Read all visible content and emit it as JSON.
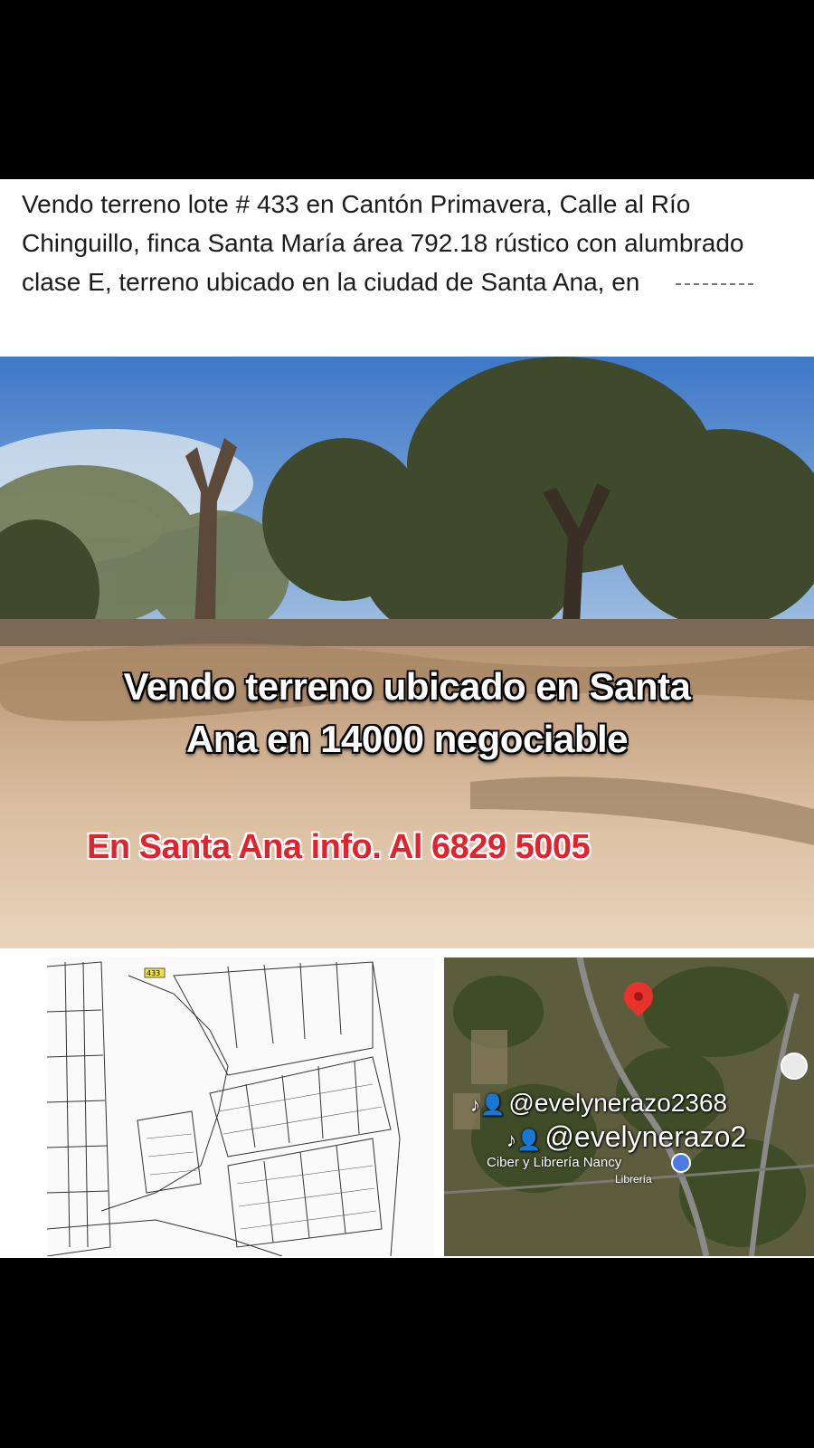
{
  "post": {
    "text": "Vendo terreno lote # 433 en Cantón Primavera, Calle al Río Chinguillo, finca Santa María área 792.18 rústico con alumbrado clase E, terreno ubicado en la ciudad de Santa Ana, en"
  },
  "photo": {
    "headline_line1": "Vendo terreno ubicado en Santa",
    "headline_line2": "Ana en 14000 negociable",
    "contact": "En Santa Ana info. Al 6829 5005"
  },
  "map": {
    "watermark_1": "@evelynerazo2368",
    "watermark_2": "@evelynerazo2",
    "place_name": "Ciber y Librería Nancy",
    "place_type": "Librería",
    "plan_label": "433"
  },
  "colors": {
    "contact_red": "#e0242f",
    "pin_red": "#e8322a"
  },
  "icons": [
    "tiktok-icon",
    "user-icon",
    "location-pin-icon",
    "place-pin-icon"
  ]
}
